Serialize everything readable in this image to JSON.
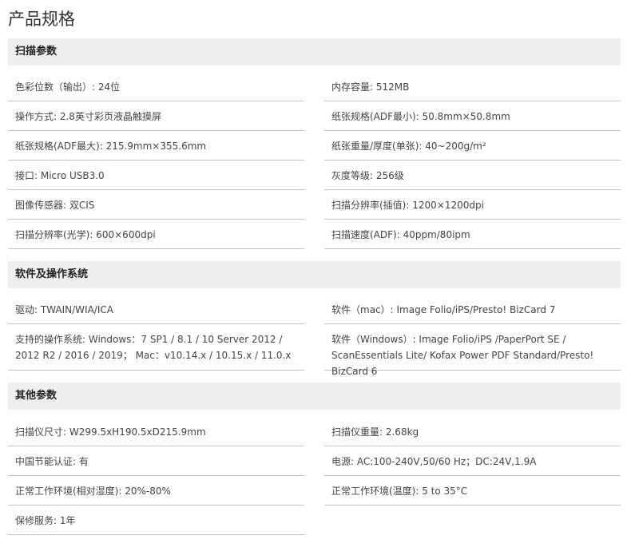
{
  "page_title": "产品规格",
  "sections": [
    {
      "title": "扫描参数",
      "rows": [
        [
          "色彩位数（输出）: 24位",
          "内存容量: 512MB"
        ],
        [
          "操作方式: 2.8英寸彩页液晶触摸屏",
          "纸张规格(ADF最小): 50.8mm×50.8mm"
        ],
        [
          "纸张规格(ADF最大): 215.9mm×355.6mm",
          "纸张重量/厚度(单张): 40~200g/m²"
        ],
        [
          "接口: Micro USB3.0",
          "灰度等级: 256级"
        ],
        [
          "图像传感器: 双CIS",
          "扫描分辨率(插值): 1200×1200dpi"
        ],
        [
          "扫描分辨率(光学): 600×600dpi",
          "扫描速度(ADF): 40ppm/80ipm"
        ]
      ]
    },
    {
      "title": "软件及操作系统",
      "rows": [
        [
          "驱动: TWAIN/WIA/ICA",
          "软件（mac）: Image Folio/iPS/Presto! BizCard 7"
        ],
        [
          "支持的操作系统: Windows：7 SP1 / 8.1 / 10 Server 2012 / 2012 R2 / 2016 / 2019； Mac：v10.14.x / 10.15.x / 11.0.x",
          "软件（Windows）: Image Folio/iPS /PaperPort SE / ScanEssentials Lite/ Kofax Power PDF Standard/Presto! BizCard 6"
        ]
      ]
    },
    {
      "title": "其他参数",
      "rows": [
        [
          "扫描仪尺寸: W299.5xH190.5xD215.9mm",
          "扫描仪重量: 2.68kg"
        ],
        [
          "中国节能认证: 有",
          "电源: AC:100-240V,50/60 Hz；DC:24V,1.9A"
        ],
        [
          "正常工作环境(相对湿度): 20%-80%",
          "正常工作环境(温度): 5 to 35°C"
        ],
        [
          "保修服务: 1年",
          ""
        ]
      ]
    }
  ]
}
